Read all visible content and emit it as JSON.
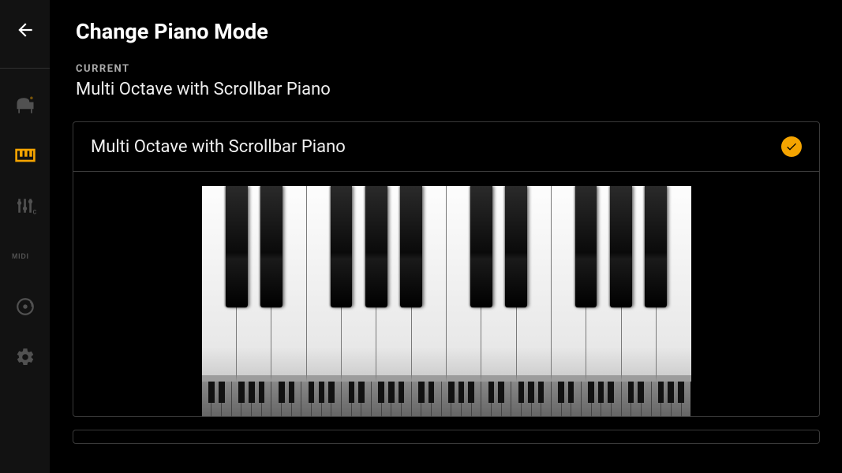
{
  "header": {
    "title": "Change Piano Mode"
  },
  "current": {
    "label": "CURRENT",
    "name": "Multi Octave with Scrollbar Piano"
  },
  "option": {
    "title": "Multi Octave with Scrollbar Piano",
    "selected": true
  },
  "sidebar": {
    "items": [
      {
        "name": "piano",
        "active": false
      },
      {
        "name": "keyboard",
        "active": true
      },
      {
        "name": "sliders",
        "active": false
      },
      {
        "name": "midi",
        "active": false
      },
      {
        "name": "disc",
        "active": false
      },
      {
        "name": "settings",
        "active": false
      }
    ]
  },
  "piano": {
    "white_keys": 14,
    "black_positions_by_white_gap": [
      0,
      1,
      3,
      4,
      5,
      7,
      8,
      10,
      11,
      12
    ],
    "mini_white_keys": 49,
    "mini_pattern7": [
      true,
      true,
      false,
      true,
      true,
      true,
      false
    ]
  },
  "colors": {
    "accent": "#f5a400"
  }
}
